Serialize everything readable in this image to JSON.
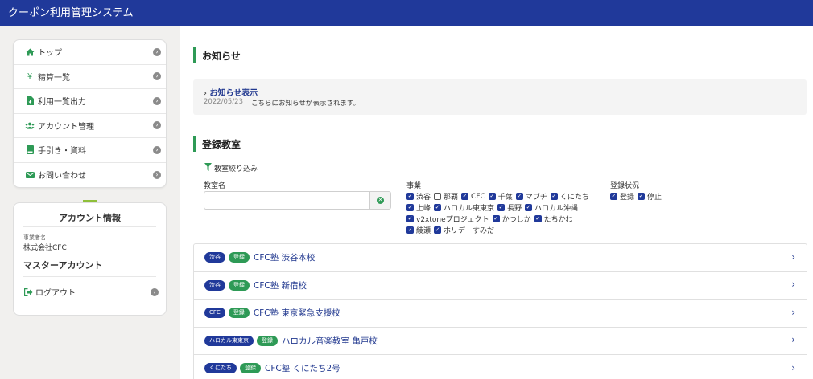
{
  "app": {
    "title": "クーポン利用管理システム"
  },
  "sidebar": {
    "menu": [
      {
        "label": "トップ",
        "icon": "home-icon"
      },
      {
        "label": "精算一覧",
        "icon": "yen-icon"
      },
      {
        "label": "利用一覧出力",
        "icon": "file-download-icon"
      },
      {
        "label": "アカウント管理",
        "icon": "users-icon"
      },
      {
        "label": "手引き・資料",
        "icon": "book-icon"
      },
      {
        "label": "お問い合わせ",
        "icon": "envelope-icon"
      }
    ],
    "account": {
      "title": "アカウント情報",
      "business_label": "事業者名",
      "company": "株式会社CFC",
      "role": "マスターアカウント",
      "logout": "ログアウト"
    }
  },
  "notices": {
    "title": "お知らせ",
    "link": "お知らせ表示",
    "date": "2022/05/23",
    "text": "こちらにお知らせが表示されます。"
  },
  "schools": {
    "title": "登録教室",
    "filter": {
      "toggle": "教室絞り込み",
      "name_label": "教室名",
      "name_value": "",
      "business_label": "事業",
      "business_options": [
        {
          "label": "渋谷",
          "checked": true
        },
        {
          "label": "那覇",
          "checked": false
        },
        {
          "label": "CFC",
          "checked": true
        },
        {
          "label": "千葉",
          "checked": true
        },
        {
          "label": "マブチ",
          "checked": true
        },
        {
          "label": "くにたち",
          "checked": true
        },
        {
          "label": "上峰",
          "checked": true
        },
        {
          "label": "ハロカル東東京",
          "checked": true
        },
        {
          "label": "長野",
          "checked": true
        },
        {
          "label": "ハロカル沖縄",
          "checked": true
        },
        {
          "label": "v2xtoneプロジェクト",
          "checked": true
        },
        {
          "label": "かつしか",
          "checked": true
        },
        {
          "label": "たちかわ",
          "checked": true
        },
        {
          "label": "綾瀬",
          "checked": true
        },
        {
          "label": "ホリデーすみだ",
          "checked": true
        }
      ],
      "status_label": "登録状況",
      "status_options": [
        {
          "label": "登録",
          "checked": true
        },
        {
          "label": "停止",
          "checked": true
        }
      ]
    },
    "rows": [
      {
        "business": "渋谷",
        "status": "登録",
        "name": "CFC塾 渋谷本校"
      },
      {
        "business": "渋谷",
        "status": "登録",
        "name": "CFC塾 新宿校"
      },
      {
        "business": "CFC",
        "status": "登録",
        "name": "CFC塾 東京緊急支援校"
      },
      {
        "business": "ハロカル東東京",
        "status": "登録",
        "name": "ハロカル音楽教室 亀戸校"
      },
      {
        "business": "くにたち",
        "status": "登録",
        "name": "CFC塾 くにたち2号"
      }
    ]
  },
  "colors": {
    "header": "#20399a",
    "accent_green": "#2e9a56",
    "link": "#21388f"
  }
}
